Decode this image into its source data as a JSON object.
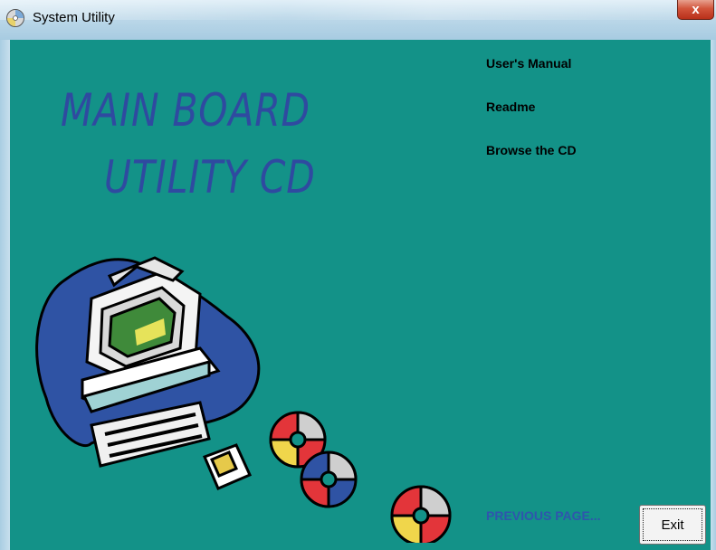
{
  "window": {
    "title": "System Utility",
    "close_label": "x"
  },
  "heading": {
    "line1": "MAIN BOARD",
    "line2": "UTILITY  CD"
  },
  "links": {
    "users_manual": "User's Manual",
    "readme": "Readme",
    "browse_cd": "Browse the CD"
  },
  "footer": {
    "previous_page": "PREVIOUS PAGE...",
    "exit_label": "Exit"
  },
  "colors": {
    "background": "#139288",
    "heading": "#2f4aa0",
    "previous_page": "#2f55ad"
  },
  "icons": [
    "app-disc-icon",
    "close-icon",
    "computer-illustration",
    "floppy-disk-icon",
    "cd-icon"
  ]
}
